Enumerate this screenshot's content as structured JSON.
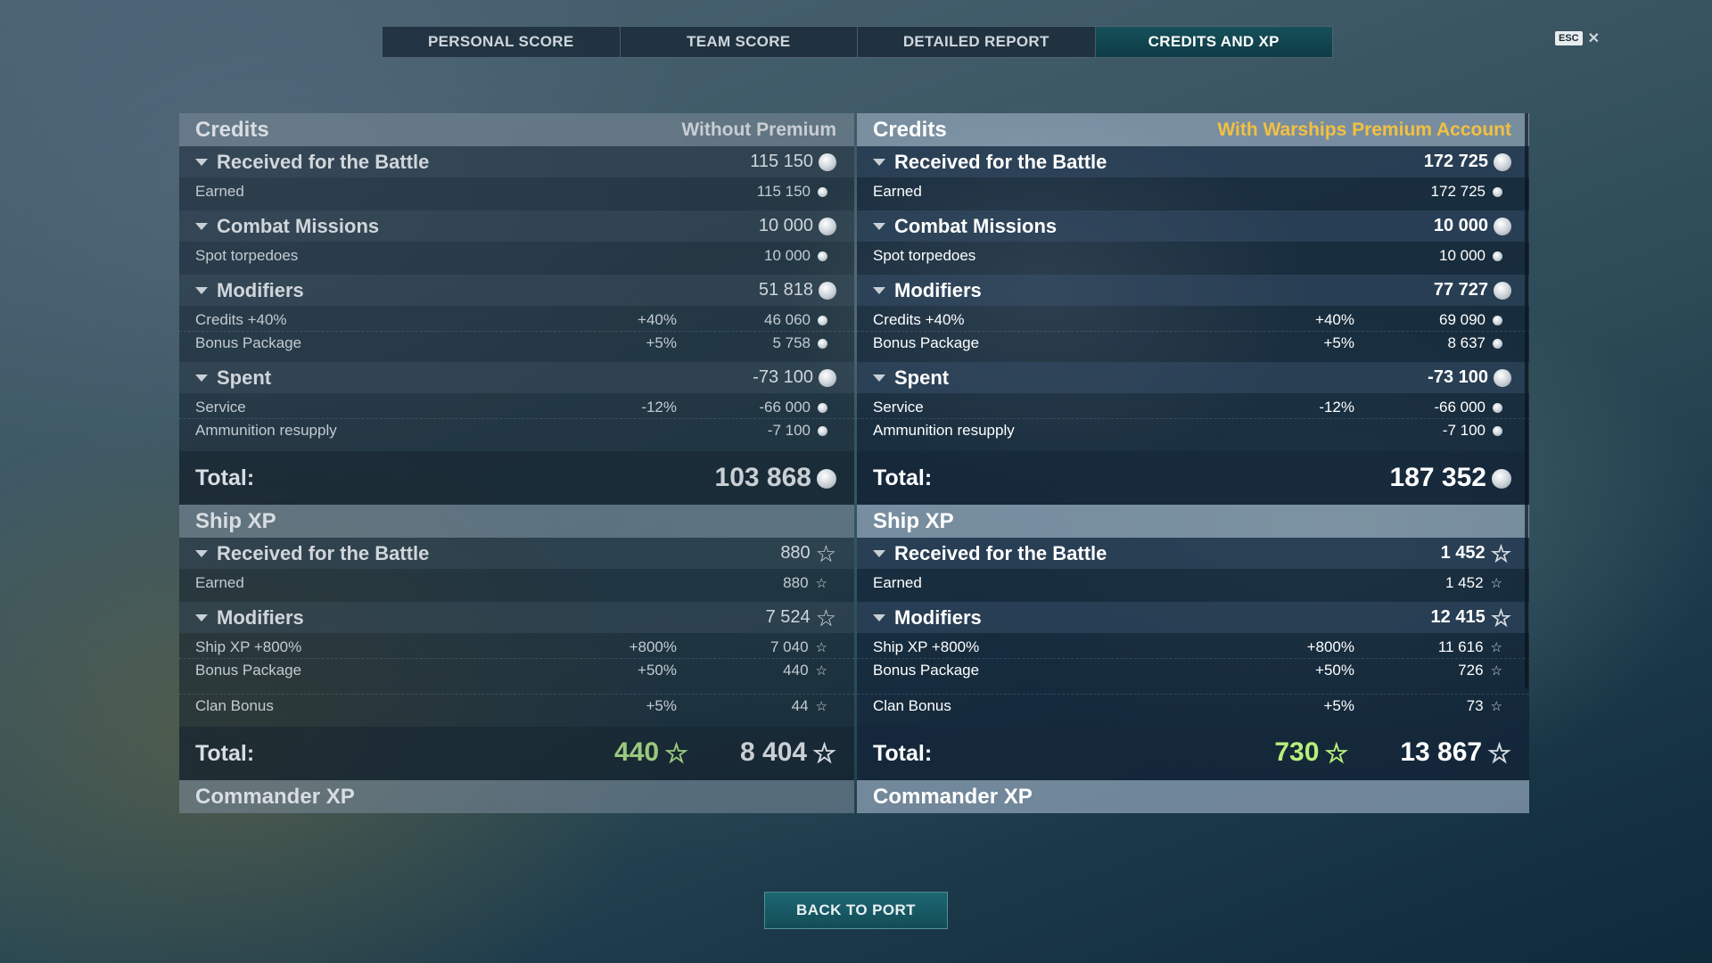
{
  "tabs": [
    "PERSONAL SCORE",
    "TEAM SCORE",
    "DETAILED REPORT",
    "CREDITS AND XP"
  ],
  "esc": {
    "key": "ESC",
    "close": "✕"
  },
  "left": {
    "credits": {
      "title": "Credits",
      "subtitle": "Without Premium",
      "received": {
        "label": "Received for the Battle",
        "value": "115 150",
        "rows": [
          {
            "label": "Earned",
            "pct": "",
            "value": "115 150"
          }
        ]
      },
      "missions": {
        "label": "Combat Missions",
        "value": "10 000",
        "rows": [
          {
            "label": "Spot torpedoes",
            "pct": "",
            "value": "10 000"
          }
        ]
      },
      "modifiers": {
        "label": "Modifiers",
        "value": "51 818",
        "rows": [
          {
            "label": "Credits +40%",
            "pct": "+40%",
            "value": "46 060"
          },
          {
            "label": "Bonus Package",
            "pct": "+5%",
            "value": "5 758"
          }
        ]
      },
      "spent": {
        "label": "Spent",
        "value": "-73 100",
        "rows": [
          {
            "label": "Service",
            "pct": "-12%",
            "value": "-66 000"
          },
          {
            "label": "Ammunition resupply",
            "pct": "",
            "value": "-7 100"
          }
        ]
      },
      "total_label": "Total:",
      "total": "103 868"
    },
    "shipxp": {
      "title": "Ship XP",
      "received": {
        "label": "Received for the Battle",
        "value": "880",
        "rows": [
          {
            "label": "Earned",
            "pct": "",
            "value": "880"
          }
        ]
      },
      "modifiers": {
        "label": "Modifiers",
        "value": "7 524",
        "rows": [
          {
            "label": "Ship XP +800%",
            "pct": "+800%",
            "value": "7 040"
          },
          {
            "label": "Bonus Package",
            "pct": "+50%",
            "value": "440"
          },
          {
            "label": "Clan Bonus",
            "pct": "+5%",
            "value": "44"
          }
        ]
      },
      "total_label": "Total:",
      "free_xp": "440",
      "total": "8 404"
    },
    "commander_title": "Commander XP"
  },
  "right": {
    "credits": {
      "title": "Credits",
      "subtitle": "With Warships Premium Account",
      "received": {
        "label": "Received for the Battle",
        "value": "172 725",
        "rows": [
          {
            "label": "Earned",
            "pct": "",
            "value": "172 725"
          }
        ]
      },
      "missions": {
        "label": "Combat Missions",
        "value": "10 000",
        "rows": [
          {
            "label": "Spot torpedoes",
            "pct": "",
            "value": "10 000"
          }
        ]
      },
      "modifiers": {
        "label": "Modifiers",
        "value": "77 727",
        "rows": [
          {
            "label": "Credits +40%",
            "pct": "+40%",
            "value": "69 090"
          },
          {
            "label": "Bonus Package",
            "pct": "+5%",
            "value": "8 637"
          }
        ]
      },
      "spent": {
        "label": "Spent",
        "value": "-73 100",
        "rows": [
          {
            "label": "Service",
            "pct": "-12%",
            "value": "-66 000"
          },
          {
            "label": "Ammunition resupply",
            "pct": "",
            "value": "-7 100"
          }
        ]
      },
      "total_label": "Total:",
      "total": "187 352"
    },
    "shipxp": {
      "title": "Ship XP",
      "received": {
        "label": "Received for the Battle",
        "value": "1 452",
        "rows": [
          {
            "label": "Earned",
            "pct": "",
            "value": "1 452"
          }
        ]
      },
      "modifiers": {
        "label": "Modifiers",
        "value": "12 415",
        "rows": [
          {
            "label": "Ship XP +800%",
            "pct": "+800%",
            "value": "11 616"
          },
          {
            "label": "Bonus Package",
            "pct": "+50%",
            "value": "726"
          },
          {
            "label": "Clan Bonus",
            "pct": "+5%",
            "value": "73"
          }
        ]
      },
      "total_label": "Total:",
      "free_xp": "730",
      "total": "13 867"
    },
    "commander_title": "Commander XP"
  },
  "back_button": "BACK TO PORT",
  "colors": {
    "premium_accent": "#f3c041",
    "free_xp_green": "#b6ef7a",
    "active_tab": "#16505a"
  },
  "icons": {
    "credits": "silver-coin-icon",
    "xp": "star-icon"
  }
}
